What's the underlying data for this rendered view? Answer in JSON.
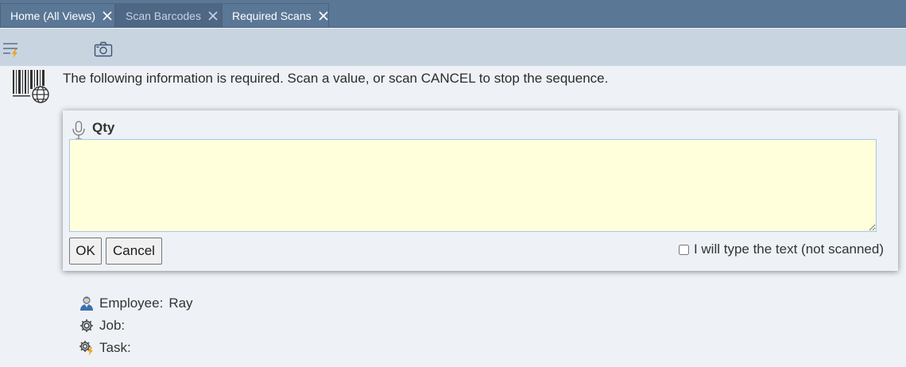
{
  "tabs": [
    {
      "label": "Home (All Views)"
    },
    {
      "label": "Scan Barcodes"
    },
    {
      "label": "Required Scans"
    }
  ],
  "toolbar": {
    "icons": [
      "menu-lightning-icon",
      "camera-icon"
    ]
  },
  "instruction": {
    "text": "The following information is required. Scan a value, or scan CANCEL to stop the sequence."
  },
  "scan_dialog": {
    "field_label": "Qty",
    "input_value": "",
    "ok_label": "OK",
    "cancel_label": "Cancel",
    "type_option_label": "I will type the text (not scanned)",
    "type_option_checked": false
  },
  "info": {
    "employee_label": "Employee:",
    "employee_value": "Ray",
    "job_label": "Job:",
    "task_label": "Task:"
  },
  "colors": {
    "tab_bar": "#5b7796",
    "toolbar": "#c8d5e1",
    "input_bg": "#ffffdc",
    "page_bg": "#eef2f6"
  }
}
